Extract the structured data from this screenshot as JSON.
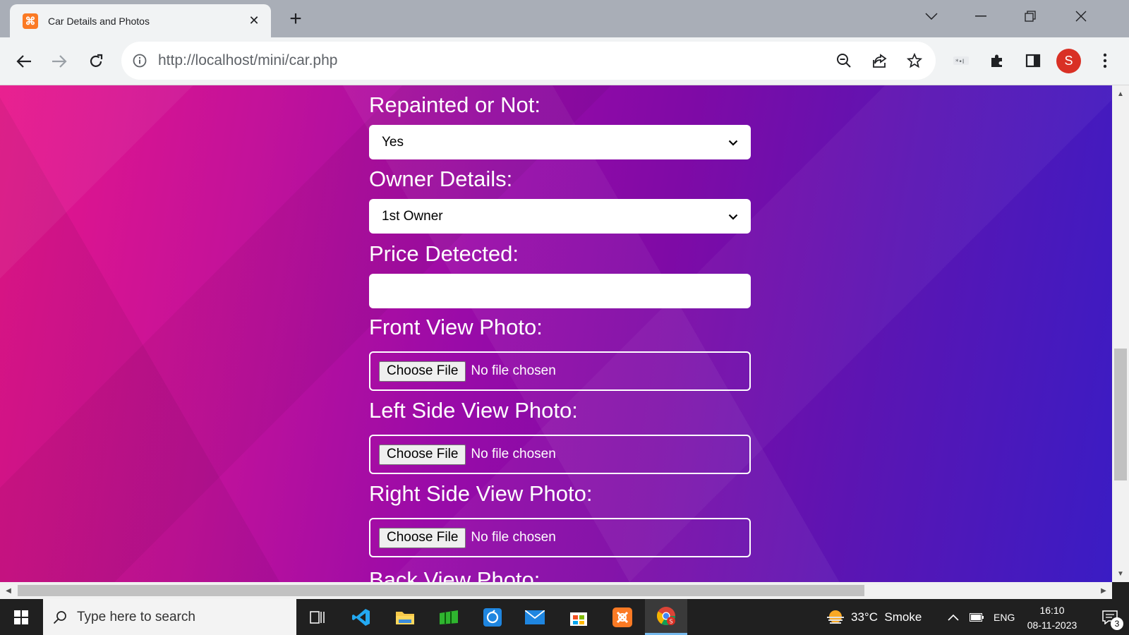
{
  "browser": {
    "tab_title": "Car Details and Photos",
    "new_tab": "+",
    "url": "http://localhost/mini/car.php",
    "profile_initial": "S"
  },
  "form": {
    "repainted": {
      "label": "Repainted or Not:",
      "value": "Yes"
    },
    "owner": {
      "label": "Owner Details:",
      "value": "1st Owner"
    },
    "price": {
      "label": "Price Detected:",
      "value": ""
    },
    "front_photo": {
      "label": "Front View Photo:",
      "button": "Choose File",
      "status": "No file chosen"
    },
    "left_photo": {
      "label": "Left Side View Photo:",
      "button": "Choose File",
      "status": "No file chosen"
    },
    "right_photo": {
      "label": "Right Side View Photo:",
      "button": "Choose File",
      "status": "No file chosen"
    },
    "back_photo": {
      "label": "Back View Photo:"
    }
  },
  "taskbar": {
    "search_placeholder": "Type here to search",
    "weather": "33°C  Smoke",
    "language": "ENG",
    "time": "16:10",
    "date": "08-11-2023",
    "notification_count": "3"
  },
  "colors": {
    "gradient_start": "#e8158a",
    "gradient_end": "#3a1cc4",
    "avatar": "#d93025",
    "tab_favicon": "#fb7a24"
  }
}
